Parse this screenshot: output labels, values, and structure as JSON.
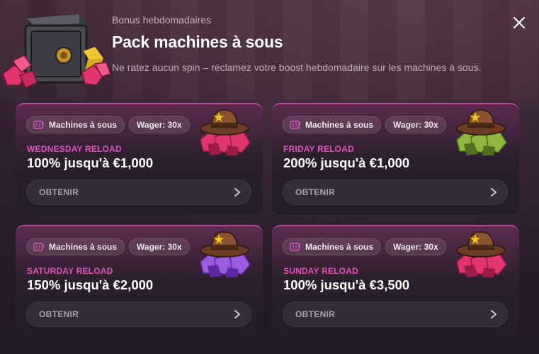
{
  "header": {
    "eyebrow": "Bonus hebdomadaires",
    "title": "Pack machines à sous",
    "subtitle": "Ne ratez aucun spin – réclamez votre boost hebdomadaire sur les machines à sous."
  },
  "close_icon": "close-icon",
  "cards": [
    {
      "tag_category": "Machines à sous",
      "tag_wager": "Wager: 30x",
      "label": "WEDNESDAY RELOAD",
      "amount": "100% jusqu'à €1,000",
      "button": "OBTENIR",
      "gem_color": "#e0356e",
      "gem_dark": "#9c1c48"
    },
    {
      "tag_category": "Machines à sous",
      "tag_wager": "Wager: 30x",
      "label": "FRIDAY RELOAD",
      "amount": "200% jusqu'à €1,000",
      "button": "OBTENIR",
      "gem_color": "#8fb83e",
      "gem_dark": "#4e7122"
    },
    {
      "tag_category": "Machines à sous",
      "tag_wager": "Wager: 30x",
      "label": "SATURDAY RELOAD",
      "amount": "150% jusqu'à €2,000",
      "button": "OBTENIR",
      "gem_color": "#9b5ce0",
      "gem_dark": "#5b2aa1"
    },
    {
      "tag_category": "Machines à sous",
      "tag_wager": "Wager: 30x",
      "label": "SUNDAY RELOAD",
      "amount": "100% jusqu'à €3,500",
      "button": "OBTENIR",
      "gem_color": "#e0356e",
      "gem_dark": "#9c1c48"
    }
  ]
}
